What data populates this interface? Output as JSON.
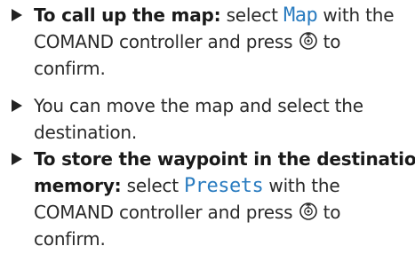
{
  "steps": [
    {
      "bold_label": "To call up the map:",
      "text_1": " select ",
      "ui_term": "Map",
      "text_2": " with the",
      "line2": "COMAND controller and press ",
      "line2_after": " to",
      "line3": "confirm."
    },
    {
      "line1": "You can move the map and select the",
      "line2": "destination."
    },
    {
      "bold_line1": "To store the waypoint in the destination",
      "bold_label2": "memory:",
      "text_1": " select ",
      "ui_term": "Presets",
      "text_2": " with the",
      "line3": "COMAND controller and press ",
      "line3_after": " to",
      "line4": "confirm."
    }
  ],
  "icons": {
    "bullet": "triangle-bullet-icon",
    "controller": "controller-press-icon"
  },
  "colors": {
    "text": "#2a2a2a",
    "ui_term": "#2a7cc0"
  }
}
